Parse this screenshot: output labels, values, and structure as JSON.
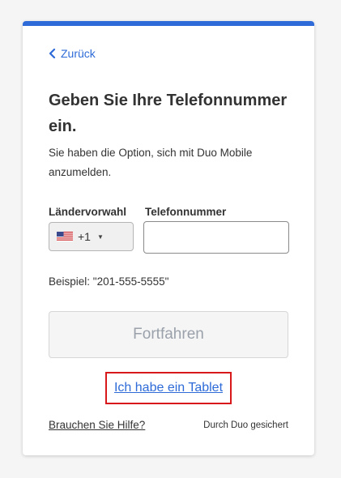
{
  "colors": {
    "accent": "#2e6bd8",
    "link": "#2e6bd8",
    "highlight_border": "#d7191b",
    "disabled_text": "#9aa1ab"
  },
  "back": {
    "icon": "chevron-left-icon",
    "label": "Zurück"
  },
  "title": "Geben Sie Ihre Telefonnummer ein.",
  "subtitle": "Sie haben die Option, sich mit Duo Mobile anzumelden.",
  "form": {
    "country_label": "Ländervorwahl",
    "country_flag": "us-flag-icon",
    "country_code": "+1",
    "phone_label": "Telefonnummer",
    "phone_value": "",
    "example": "Beispiel: \"201-555-5555\""
  },
  "continue_label": "Fortfahren",
  "tablet_link": "Ich habe ein Tablet",
  "help_link": "Brauchen Sie Hilfe?",
  "secured_by": "Durch Duo gesichert"
}
